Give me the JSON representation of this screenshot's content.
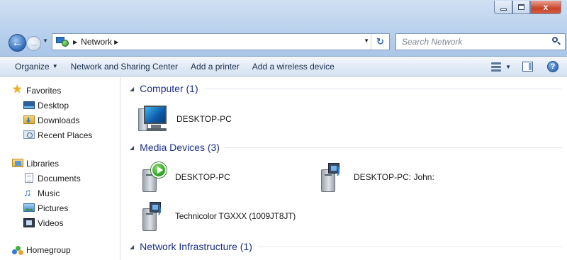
{
  "window": {
    "controls": {
      "minimize": "",
      "maximize": "",
      "close": "x"
    }
  },
  "nav": {
    "back_icon": "arrow-left-icon",
    "forward_icon": "arrow-right-icon",
    "address_icon": "network-icon",
    "address_path": "Network",
    "search_placeholder": "Search Network"
  },
  "commandbar": {
    "organize": "Organize",
    "items": [
      "Network and Sharing Center",
      "Add a printer",
      "Add a wireless device"
    ]
  },
  "navpane": {
    "favorites": {
      "label": "Favorites",
      "items": [
        "Desktop",
        "Downloads",
        "Recent Places"
      ]
    },
    "libraries": {
      "label": "Libraries",
      "items": [
        "Documents",
        "Music",
        "Pictures",
        "Videos"
      ]
    },
    "homegroup": "Homegroup"
  },
  "content": {
    "groups": [
      {
        "title": "Computer (1)",
        "items": [
          "DESKTOP-PC"
        ]
      },
      {
        "title": "Media Devices (3)",
        "items": [
          "DESKTOP-PC",
          "DESKTOP-PC: John:",
          "Technicolor TGXXX (1009JT8JT)"
        ]
      },
      {
        "title": "Network Infrastructure (1)",
        "items": []
      }
    ]
  }
}
